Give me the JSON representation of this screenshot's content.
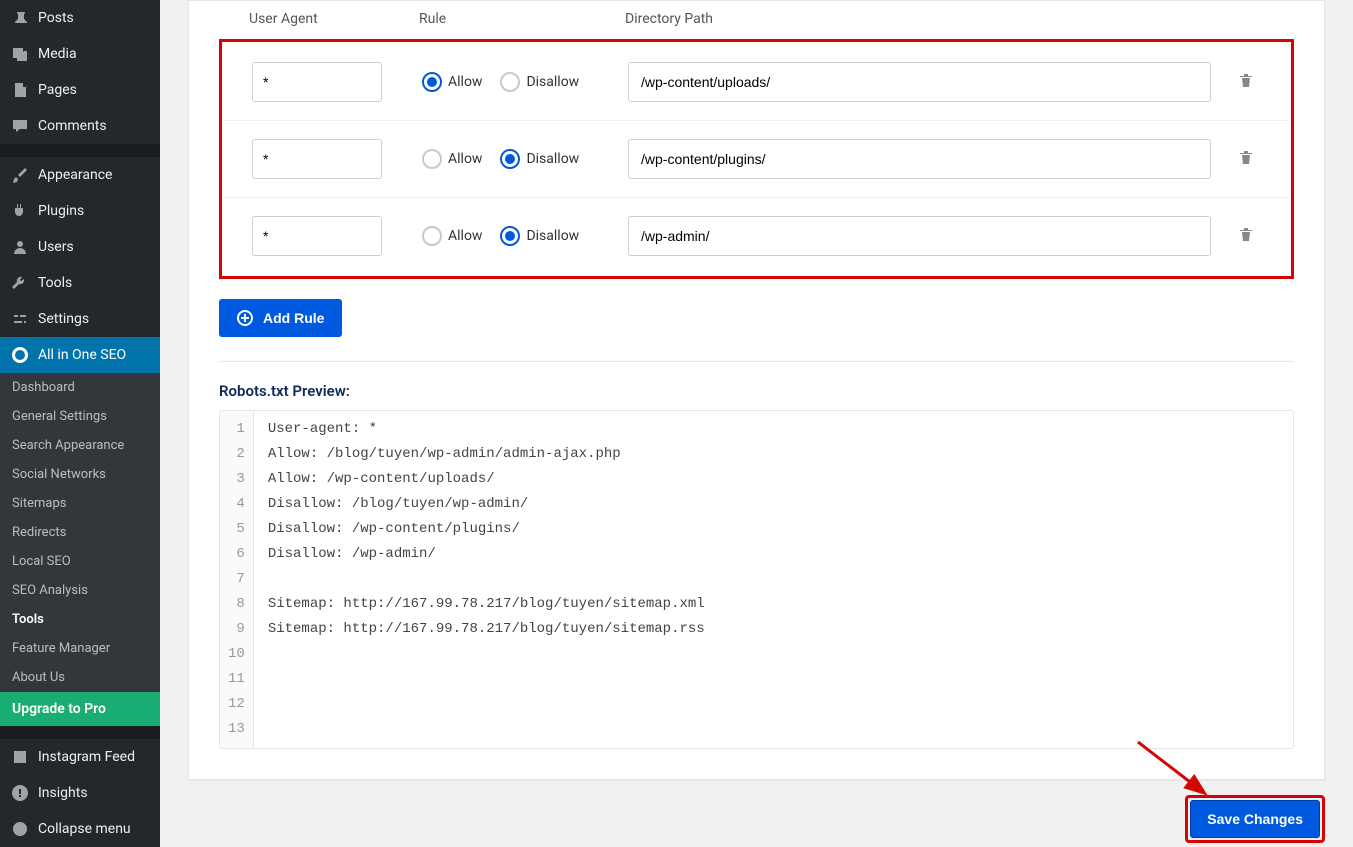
{
  "sidebar": {
    "items": [
      {
        "label": "Posts",
        "icon": "pin"
      },
      {
        "label": "Media",
        "icon": "media"
      },
      {
        "label": "Pages",
        "icon": "page"
      },
      {
        "label": "Comments",
        "icon": "comment"
      },
      {
        "label": "Appearance",
        "icon": "brush"
      },
      {
        "label": "Plugins",
        "icon": "plugin"
      },
      {
        "label": "Users",
        "icon": "user"
      },
      {
        "label": "Tools",
        "icon": "wrench"
      },
      {
        "label": "Settings",
        "icon": "sliders"
      },
      {
        "label": "All in One SEO",
        "icon": "aioseo"
      }
    ],
    "sub": [
      "Dashboard",
      "General Settings",
      "Search Appearance",
      "Social Networks",
      "Sitemaps",
      "Redirects",
      "Local SEO",
      "SEO Analysis",
      "Tools",
      "Feature Manager",
      "About Us"
    ],
    "sub_active": "Tools",
    "upgrade": "Upgrade to Pro",
    "bottom": [
      {
        "label": "Instagram Feed",
        "icon": "feed"
      },
      {
        "label": "Insights",
        "icon": "insights"
      },
      {
        "label": "Collapse menu",
        "icon": "collapse"
      }
    ]
  },
  "table": {
    "headers": {
      "ua": "User Agent",
      "rule": "Rule",
      "dp": "Directory Path"
    },
    "allow_label": "Allow",
    "disallow_label": "Disallow",
    "rows": [
      {
        "ua": "*",
        "rule": "allow",
        "dp": "/wp-content/uploads/"
      },
      {
        "ua": "*",
        "rule": "disallow",
        "dp": "/wp-content/plugins/"
      },
      {
        "ua": "*",
        "rule": "disallow",
        "dp": "/wp-admin/"
      }
    ],
    "add_button": "Add Rule"
  },
  "preview": {
    "heading": "Robots.txt Preview:",
    "lines": [
      "User-agent: *",
      "Allow: /blog/tuyen/wp-admin/admin-ajax.php",
      "Allow: /wp-content/uploads/",
      "Disallow: /blog/tuyen/wp-admin/",
      "Disallow: /wp-content/plugins/",
      "Disallow: /wp-admin/",
      "",
      "Sitemap: http://167.99.78.217/blog/tuyen/sitemap.xml",
      "Sitemap: http://167.99.78.217/blog/tuyen/sitemap.rss",
      "",
      "",
      "",
      ""
    ]
  },
  "save_button": "Save Changes"
}
